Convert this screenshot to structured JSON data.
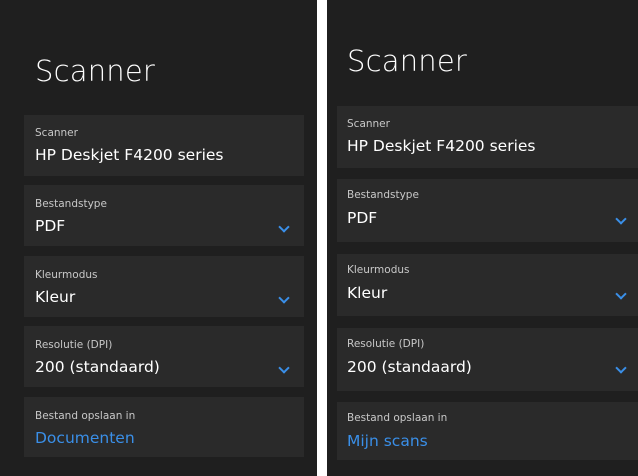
{
  "panels": [
    {
      "title": "Scanner",
      "fields": [
        {
          "label": "Scanner",
          "value": "HP Deskjet F4200 series"
        },
        {
          "label": "Bestandstype",
          "value": "PDF"
        },
        {
          "label": "Kleurmodus",
          "value": "Kleur"
        },
        {
          "label": "Resolutie (DPI)",
          "value": "200 (standaard)"
        },
        {
          "label": "Bestand opslaan in",
          "value": "Documenten"
        }
      ]
    },
    {
      "title": "Scanner",
      "fields": [
        {
          "label": "Scanner",
          "value": "HP Deskjet F4200 series"
        },
        {
          "label": "Bestandstype",
          "value": "PDF"
        },
        {
          "label": "Kleurmodus",
          "value": "Kleur"
        },
        {
          "label": "Resolutie (DPI)",
          "value": "200 (standaard)"
        },
        {
          "label": "Bestand opslaan in",
          "value": "Mijn scans"
        }
      ]
    }
  ],
  "colors": {
    "background": "#1f1f1f",
    "row": "#2a2a2a",
    "accent": "#3a8fe8",
    "text": "#ffffff",
    "label": "#c8c8c8"
  },
  "icons": {
    "dropdown": "chevron-down-icon"
  }
}
